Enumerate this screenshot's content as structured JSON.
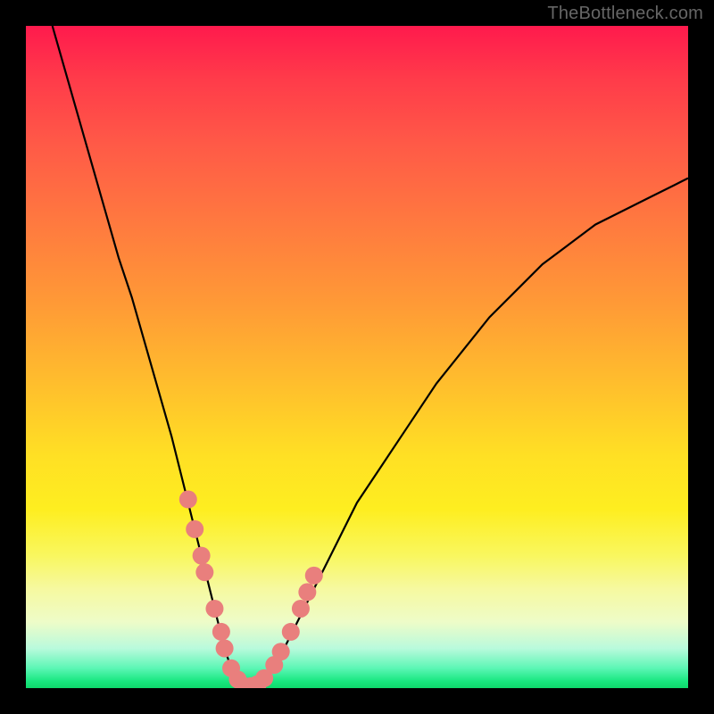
{
  "watermark": {
    "text": "TheBottleneck.com"
  },
  "colors": {
    "dot_fill": "#e97f7d",
    "curve_stroke": "#000000",
    "frame_bg": "#000000"
  },
  "chart_data": {
    "type": "line",
    "title": "",
    "xlabel": "",
    "ylabel": "",
    "xlim": [
      0,
      100
    ],
    "ylim": [
      0,
      100
    ],
    "grid": false,
    "legend": false,
    "series": [
      {
        "name": "bottleneck-curve",
        "x": [
          4,
          6,
          8,
          10,
          12,
          14,
          16,
          18,
          20,
          22,
          24,
          25,
          26,
          27,
          28,
          29,
          30,
          31,
          32,
          33,
          34,
          35,
          36,
          38,
          40,
          42,
          44,
          46,
          48,
          50,
          54,
          58,
          62,
          66,
          70,
          74,
          78,
          82,
          86,
          90,
          94,
          98,
          100
        ],
        "values": [
          100,
          93,
          86,
          79,
          72,
          65,
          59,
          52,
          45,
          38,
          30,
          26,
          22,
          18,
          14,
          10,
          6,
          3,
          1,
          0,
          0,
          0,
          1,
          4,
          8,
          12,
          16,
          20,
          24,
          28,
          34,
          40,
          46,
          51,
          56,
          60,
          64,
          67,
          70,
          72,
          74,
          76,
          77
        ]
      }
    ],
    "dots": {
      "name": "sample-dots",
      "x": [
        24.5,
        25.5,
        26.5,
        27.0,
        28.5,
        29.5,
        30.0,
        31.0,
        32.0,
        33.0,
        34.0,
        35.0,
        36.0,
        37.5,
        38.5,
        40.0,
        41.5,
        42.5,
        43.5
      ],
      "values": [
        28.5,
        24.0,
        20.0,
        17.5,
        12.0,
        8.5,
        6.0,
        3.0,
        1.3,
        0.3,
        0.3,
        0.6,
        1.5,
        3.5,
        5.5,
        8.5,
        12.0,
        14.5,
        17.0
      ]
    }
  }
}
